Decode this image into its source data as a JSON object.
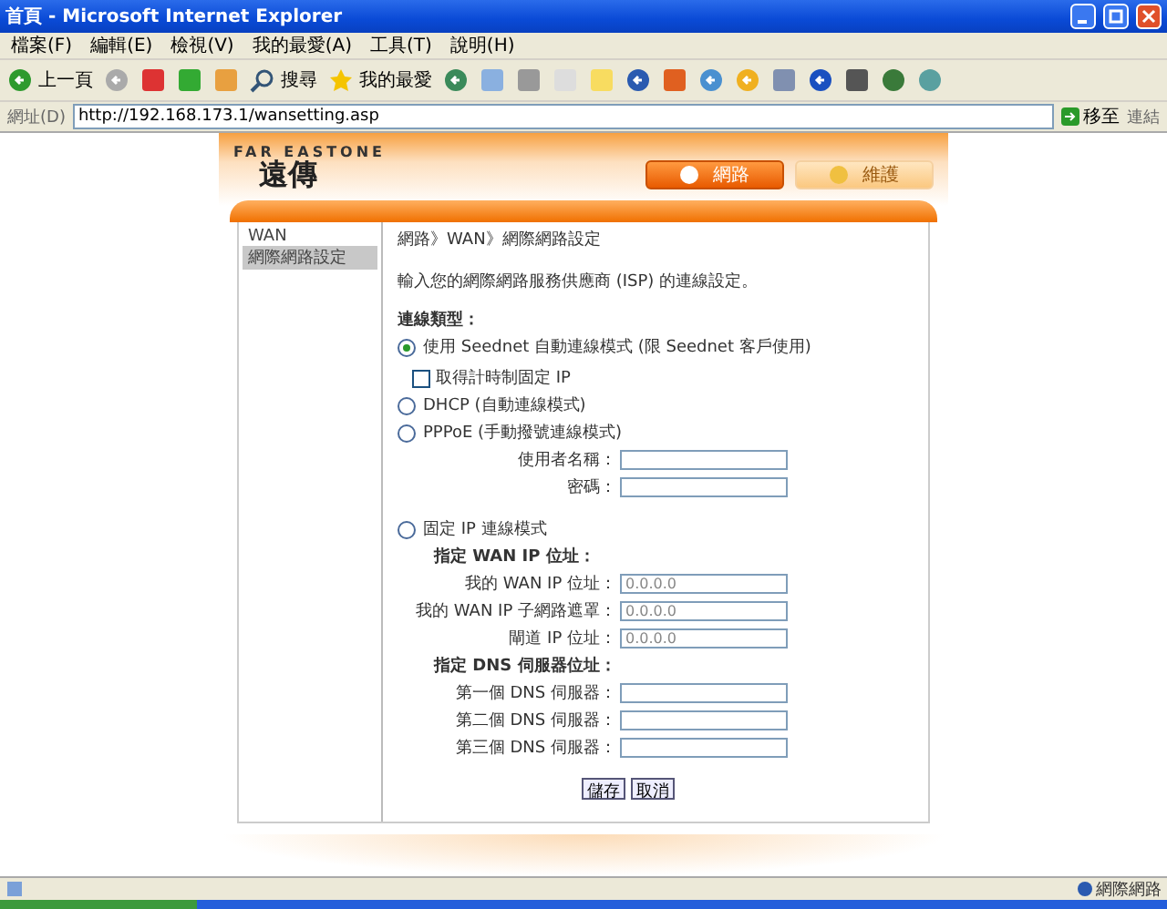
{
  "window": {
    "title": "首頁 - Microsoft Internet Explorer"
  },
  "menu": [
    "檔案(F)",
    "編輯(E)",
    "檢視(V)",
    "我的最愛(A)",
    "工具(T)",
    "說明(H)"
  ],
  "toolbar": {
    "back": "上一頁",
    "search": "搜尋",
    "favorites": "我的最愛"
  },
  "address_bar": {
    "label": "網址(D)",
    "url": "http://192.168.173.1/wansetting.asp",
    "go": "移至",
    "links": "連結"
  },
  "site": {
    "brand_latin": "FAR EASTONE",
    "brand": "遠傳",
    "nav_tabs": [
      {
        "label": "網路",
        "selected": true
      },
      {
        "label": "維護",
        "selected": false
      }
    ],
    "sidebar": {
      "items": [
        {
          "label": "WAN",
          "selected": false
        },
        {
          "label": "網際網路設定",
          "selected": true
        }
      ]
    },
    "breadcrumb": "網路》WAN》網際網路設定",
    "intro": "輸入您的網際網路服務供應商 (ISP) 的連線設定。",
    "connection_type_label": "連線類型：",
    "connection_types": [
      {
        "label": "使用 Seednet 自動連線模式 (限 Seednet 客戶使用)",
        "selected": true,
        "option": {
          "label": "取得計時制固定 IP",
          "checked": false
        }
      },
      {
        "label": "DHCP (自動連線模式)",
        "selected": false
      },
      {
        "label": "PPPoE (手動撥號連線模式)",
        "selected": false,
        "sections": [
          {
            "fields": [
              {
                "label": "使用者名稱："
              },
              {
                "label": "密碼："
              }
            ]
          }
        ]
      },
      {
        "label": "固定 IP 連線模式",
        "selected": false,
        "sections": [
          {
            "heading": "指定 WAN IP 位址：",
            "fields": [
              {
                "label": "我的 WAN IP 位址：",
                "value": "0.0.0.0"
              },
              {
                "label": "我的 WAN IP 子網路遮罩：",
                "value": "0.0.0.0"
              },
              {
                "label": "閘道 IP 位址：",
                "value": "0.0.0.0"
              }
            ]
          },
          {
            "heading": "指定 DNS 伺服器位址：",
            "fields": [
              {
                "label": "第一個 DNS 伺服器："
              },
              {
                "label": "第二個 DNS 伺服器："
              },
              {
                "label": "第三個 DNS 伺服器："
              }
            ]
          }
        ]
      }
    ],
    "buttons": [
      "儲存",
      "取消"
    ]
  },
  "status_bar": {
    "zone": "網際網路"
  }
}
